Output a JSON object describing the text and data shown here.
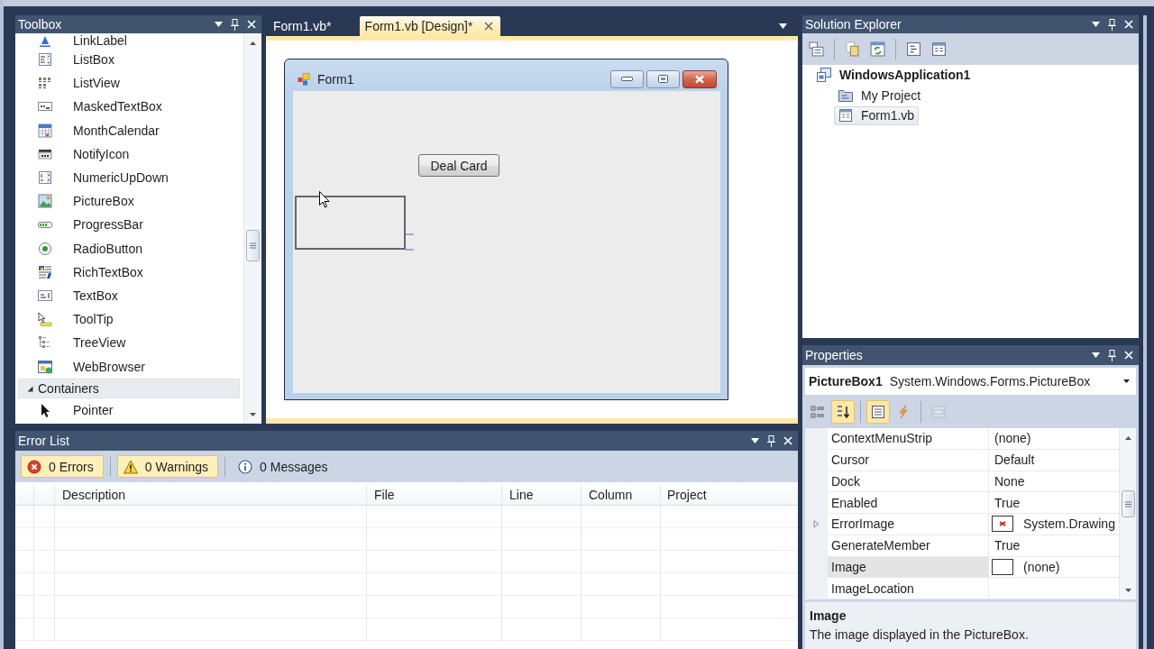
{
  "toolbox": {
    "title": "Toolbox",
    "items": [
      {
        "label": "LinkLabel",
        "selected": false
      },
      {
        "label": "ListBox",
        "selected": false
      },
      {
        "label": "ListView",
        "selected": false
      },
      {
        "label": "MaskedTextBox",
        "selected": false
      },
      {
        "label": "MonthCalendar",
        "selected": false
      },
      {
        "label": "NotifyIcon",
        "selected": false
      },
      {
        "label": "NumericUpDown",
        "selected": false
      },
      {
        "label": "PictureBox",
        "selected": false
      },
      {
        "label": "ProgressBar",
        "selected": false
      },
      {
        "label": "RadioButton",
        "selected": false
      },
      {
        "label": "RichTextBox",
        "selected": false
      },
      {
        "label": "TextBox",
        "selected": false
      },
      {
        "label": "ToolTip",
        "selected": false
      },
      {
        "label": "TreeView",
        "selected": false
      },
      {
        "label": "WebBrowser",
        "selected": false
      }
    ],
    "sections": [
      {
        "label": "Containers",
        "expanded": true,
        "items": [
          {
            "label": "Pointer",
            "selected": false
          }
        ]
      }
    ]
  },
  "document_tabs": [
    {
      "label": "Form1.vb*",
      "selected": false
    },
    {
      "label": "Form1.vb [Design]*",
      "selected": true
    }
  ],
  "designer": {
    "form": {
      "title": "Form1",
      "controls": [
        {
          "kind": "button",
          "text": "Deal Card"
        },
        {
          "kind": "picturebox"
        }
      ]
    }
  },
  "solution_explorer": {
    "title": "Solution Explorer",
    "tree": [
      {
        "label": "WindowsApplication1",
        "kind": "project",
        "selected": false,
        "children": [
          {
            "label": "My Project",
            "kind": "folder",
            "selected": false
          },
          {
            "label": "Form1.vb",
            "kind": "file",
            "selected": true
          }
        ]
      }
    ]
  },
  "properties": {
    "title": "Properties",
    "object": {
      "name": "PictureBox1",
      "type": "System.Windows.Forms.PictureBox"
    },
    "toolbar": [
      {
        "selected": false,
        "disabled": false
      },
      {
        "selected": true,
        "disabled": false
      },
      {
        "selected": true,
        "disabled": false
      },
      {
        "selected": false,
        "disabled": false
      },
      {
        "selected": false,
        "disabled": true
      }
    ],
    "rows": [
      {
        "name": "ContextMenuStrip",
        "value": "(none)",
        "kind": "text",
        "selected": false
      },
      {
        "name": "Cursor",
        "value": "Default",
        "kind": "text",
        "selected": false
      },
      {
        "name": "Dock",
        "value": "None",
        "kind": "text",
        "selected": false
      },
      {
        "name": "Enabled",
        "value": "True",
        "kind": "text",
        "selected": false
      },
      {
        "name": "ErrorImage",
        "value": "System.Drawing",
        "kind": "image",
        "expanded": false,
        "selected": false
      },
      {
        "name": "GenerateMember",
        "value": "True",
        "kind": "text",
        "selected": false
      },
      {
        "name": "Image",
        "value": "(none)",
        "kind": "blank",
        "selected": true
      },
      {
        "name": "ImageLocation",
        "kind": "text",
        "selected": false
      }
    ],
    "description": {
      "title": "Image",
      "text": "The image displayed in the PictureBox."
    }
  },
  "error_list": {
    "title": "Error List",
    "filters": [
      {
        "kind": "error",
        "label": "0 Errors",
        "selected": true
      },
      {
        "kind": "warning",
        "label": "0 Warnings",
        "selected": true
      },
      {
        "kind": "message",
        "label": "0 Messages",
        "selected": false
      }
    ],
    "columns": [
      "Description",
      "File",
      "Line",
      "Column",
      "Project"
    ]
  }
}
